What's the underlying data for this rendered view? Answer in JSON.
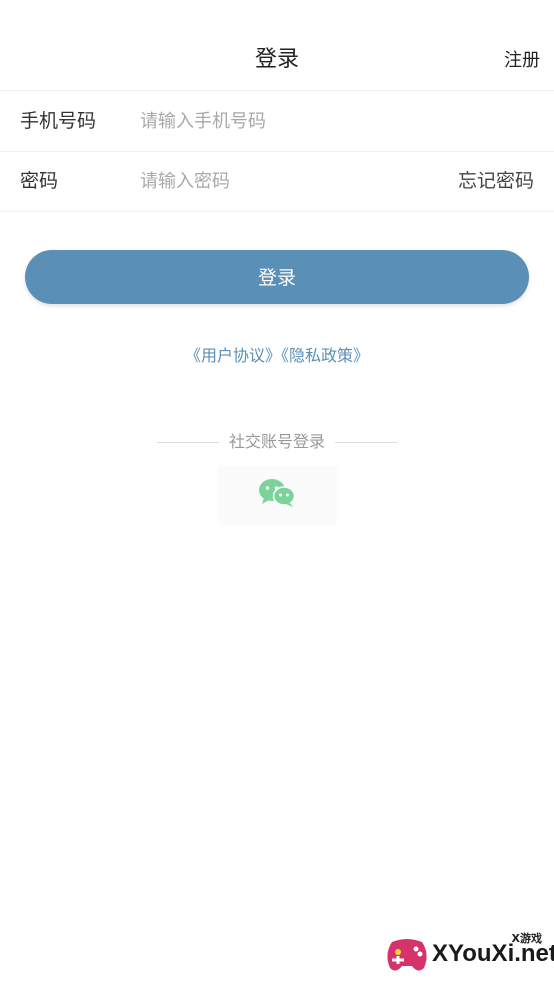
{
  "header": {
    "title": "登录",
    "register_label": "注册"
  },
  "form": {
    "phone_label": "手机号码",
    "phone_placeholder": "请输入手机号码",
    "password_label": "密码",
    "password_placeholder": "请输入密码",
    "forgot_label": "忘记密码"
  },
  "login_button_label": "登录",
  "agreements": {
    "user_agreement": "《用户协议》",
    "privacy_policy": "《隐私政策》"
  },
  "social": {
    "title": "社交账号登录",
    "providers": [
      "wechat-icon"
    ]
  },
  "watermark": {
    "small_text": "X游戏",
    "text": "XYouXi.net"
  },
  "colors": {
    "accent": "#5a8fb6",
    "wechat": "#7bd39a",
    "placeholder": "#a8a8a8"
  }
}
